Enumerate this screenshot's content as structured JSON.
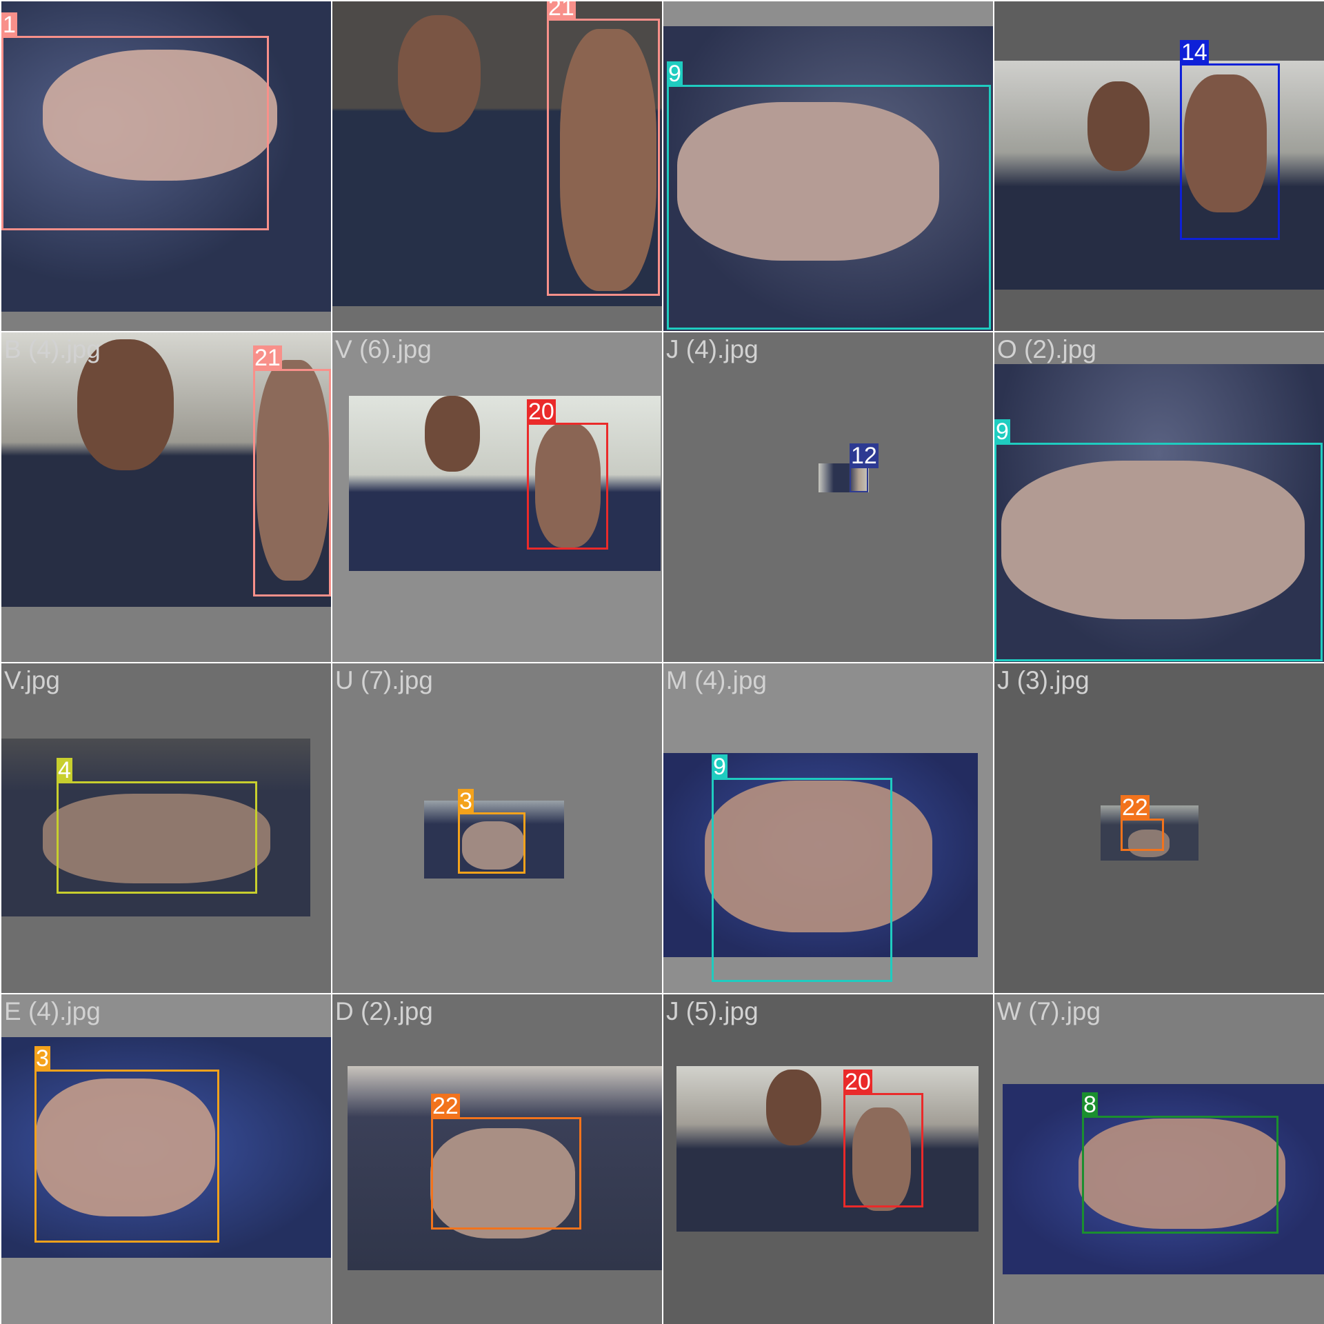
{
  "colors": {
    "c1": "#f8908a",
    "c21": "#f8908a",
    "c9": "#1fccc0",
    "c14": "#0e20d8",
    "c20": "#ea2a2a",
    "c12": "#2d3a92",
    "c4": "#c8cf2e",
    "c3": "#f4a21b",
    "c22": "#f2731c",
    "c8": "#1b8f2f",
    "shirt": "#2a3350",
    "skin": "#c9a08b"
  },
  "tiles": [
    {
      "filename": "",
      "label": "1"
    },
    {
      "filename": "",
      "label": "21"
    },
    {
      "filename": "",
      "label": "9"
    },
    {
      "filename": "",
      "label": "14"
    },
    {
      "filename": "B (4).jpg",
      "label": "21"
    },
    {
      "filename": "V (6).jpg",
      "label": "20"
    },
    {
      "filename": "J (4).jpg",
      "label": "12"
    },
    {
      "filename": "O (2).jpg",
      "label": "9"
    },
    {
      "filename": "V.jpg",
      "label": "4"
    },
    {
      "filename": "U (7).jpg",
      "label": "3"
    },
    {
      "filename": "M (4).jpg",
      "label": "9"
    },
    {
      "filename": "J (3).jpg",
      "label": "22"
    },
    {
      "filename": "E (4).jpg",
      "label": "3"
    },
    {
      "filename": "D (2).jpg",
      "label": "22"
    },
    {
      "filename": "J (5).jpg",
      "label": "20"
    },
    {
      "filename": "W (7).jpg",
      "label": "8"
    }
  ]
}
